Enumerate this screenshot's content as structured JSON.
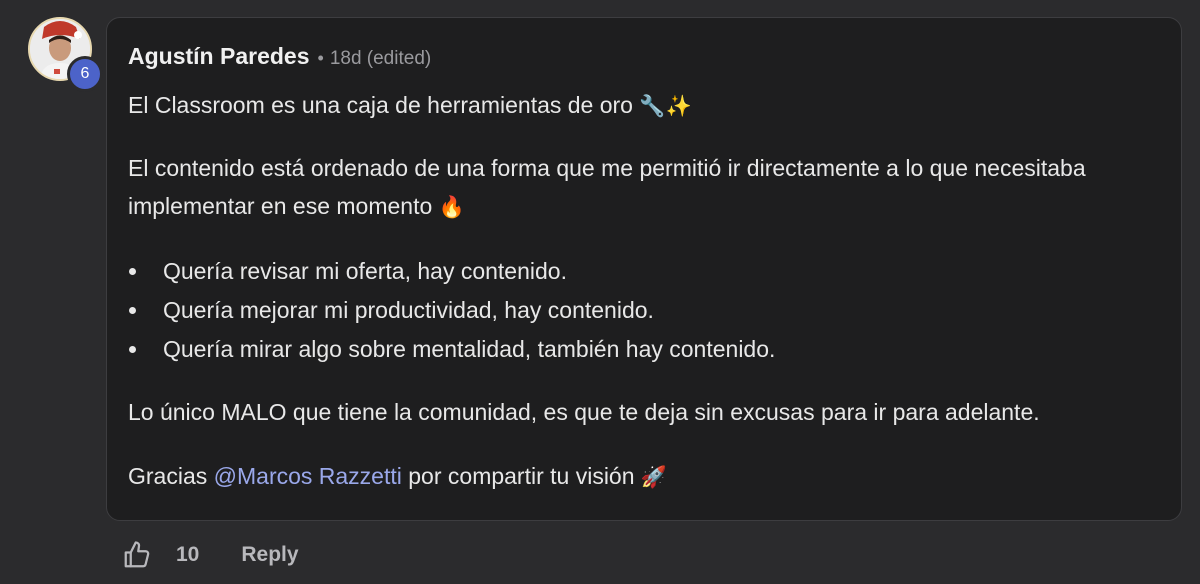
{
  "author": {
    "name": "Agustín Paredes",
    "separator": "•",
    "meta": "18d (edited)",
    "level": "6",
    "avatar_icon": "user-avatar-photo"
  },
  "post": {
    "paragraph_1": "El Classroom es una caja de herramientas de oro",
    "paragraph_1_emoji": "🔧✨",
    "paragraph_2": "El contenido está ordenado de una forma que me permitió ir directamente a lo que necesitaba implementar en ese momento",
    "paragraph_2_emoji": "🔥",
    "bullets": [
      "Quería revisar mi oferta, hay contenido.",
      "Quería mejorar mi productividad, hay contenido.",
      "Quería mirar algo sobre mentalidad, también hay contenido."
    ],
    "paragraph_4": "Lo único MALO que tiene la comunidad, es que te deja sin excusas para ir para adelante.",
    "paragraph_5_prefix": "Gracias ",
    "mention": "@Marcos Razzetti",
    "paragraph_5_suffix": " por compartir tu visión",
    "paragraph_5_emoji": "🚀"
  },
  "actions": {
    "like_icon": "thumbs-up-icon",
    "like_count": "10",
    "reply_label": "Reply"
  },
  "colors": {
    "background": "#2b2b2d",
    "card": "#1e1e1f",
    "mention": "#9aa8ea",
    "level_badge": "#4c63c9"
  }
}
